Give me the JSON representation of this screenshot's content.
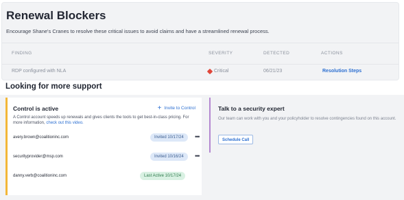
{
  "blockers": {
    "title": "Renewal Blockers",
    "subtitle": "Encourage Shane's Cranes to resolve these critical issues to avoid claims and have a streamlined renewal process.",
    "columns": [
      "FINDING",
      "SEVERITY",
      "DETECTED",
      "ACTIONS"
    ],
    "rows": [
      {
        "finding": "RDP configured with NLA",
        "severity": "Critical",
        "detected": "06/21/23",
        "action": "Resolution Steps"
      }
    ]
  },
  "support": {
    "title": "Looking for more support",
    "control": {
      "title": "Control is active",
      "invite_label": "Invite to Control",
      "description": "A Control account speeds up renewals and gives clients the tools to get best-in-class pricing. For more information,",
      "video_link": "check out this video.",
      "members": [
        {
          "email": "avery.brown@coalitioninc.com",
          "status": "Invited 10/17/24",
          "kind": "invited"
        },
        {
          "email": "securityprovider@msp.com",
          "status": "Invited 10/16/24",
          "kind": "invited"
        },
        {
          "email": "danny.verb@coalitioninc.com",
          "status": "Last Active 10/17/24",
          "kind": "active"
        }
      ]
    },
    "expert": {
      "title": "Talk to a security expert",
      "description": "Our team can work with you and your policyholder to resolve contingencies found on this account.",
      "button": "Schedule Call"
    }
  },
  "colors": {
    "control_accent": "#f3b738",
    "expert_accent": "#b488d1",
    "link": "#2c6fd1",
    "critical": "#e0473a"
  }
}
